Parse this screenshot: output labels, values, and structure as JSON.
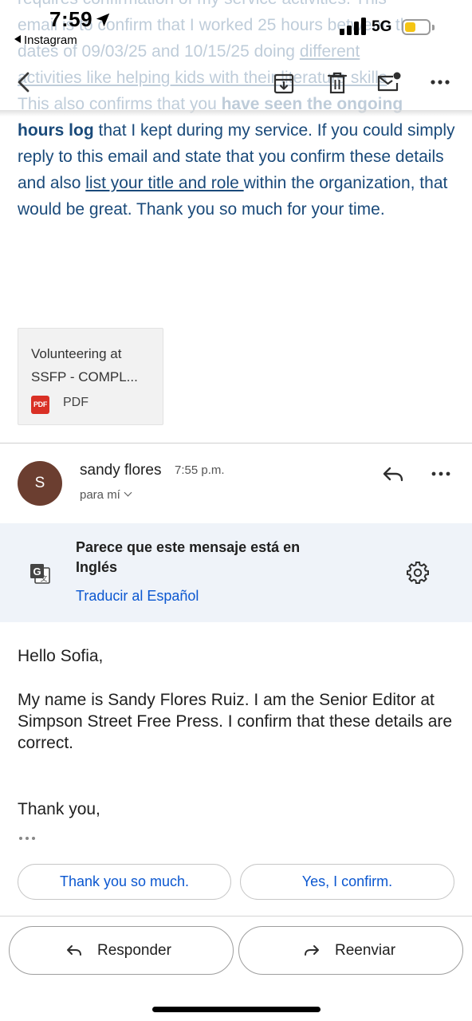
{
  "background_text": {
    "line1": "requires confirmation of my service activities. This",
    "line2_a": "email is to confirm that I worked 25 hours between the",
    "line3_a": "dates of 09/03/25 and 10/15/25 doing ",
    "line3_link": "different",
    "line4_link": "activities like helping kids with their literature skills",
    "line5_a": "This also confirms that you ",
    "line5_bold": "have seen the ongoing"
  },
  "status_bar": {
    "time": "7:59",
    "back_app": "Instagram",
    "network": "5G",
    "battery_level": 0.45,
    "signal_bars": 4
  },
  "toolbar": {
    "back_icon": "chevron-left-icon",
    "archive_icon": "archive-icon",
    "delete_icon": "trash-icon",
    "unread_icon": "mark-unread-icon",
    "more_icon": "more-horizontal-icon"
  },
  "email_body": {
    "bold_hours_log": "hours log",
    "text_after_bold": " that I kept during my service. If you could simply reply to this email and state that you confirm these details and also ",
    "link_title_role": "list your title and role ",
    "text_end": "within the organization, that would be great.  Thank you so much for your time."
  },
  "attachment": {
    "name": "Volunteering at SSFP - COMPL...",
    "type_badge": "PDF",
    "type_label": "PDF"
  },
  "message": {
    "avatar_initial": "S",
    "sender": "sandy flores",
    "time": "7:55 p.m.",
    "recipient": "para mí"
  },
  "translation_banner": {
    "title": "Parece que este mensaje está en Inglés",
    "link": "Traducir al Español"
  },
  "reply_body": {
    "greeting": "Hello Sofia,",
    "paragraph": "My name is Sandy Flores Ruiz. I am the Senior Editor at Simpson Street Free Press. I confirm that these details are correct.",
    "closing": "Thank you,"
  },
  "smart_replies": [
    "Thank you so much.",
    "Yes, I confirm."
  ],
  "actions": {
    "reply": "Responder",
    "forward": "Reenviar"
  },
  "colors": {
    "body_blue": "#1a4a7a",
    "link_blue": "#0b57d0",
    "avatar_brown": "#6b3e30",
    "banner_bg": "#eff3f9",
    "battery_yellow": "#f4c414",
    "pdf_red": "#d93025"
  }
}
